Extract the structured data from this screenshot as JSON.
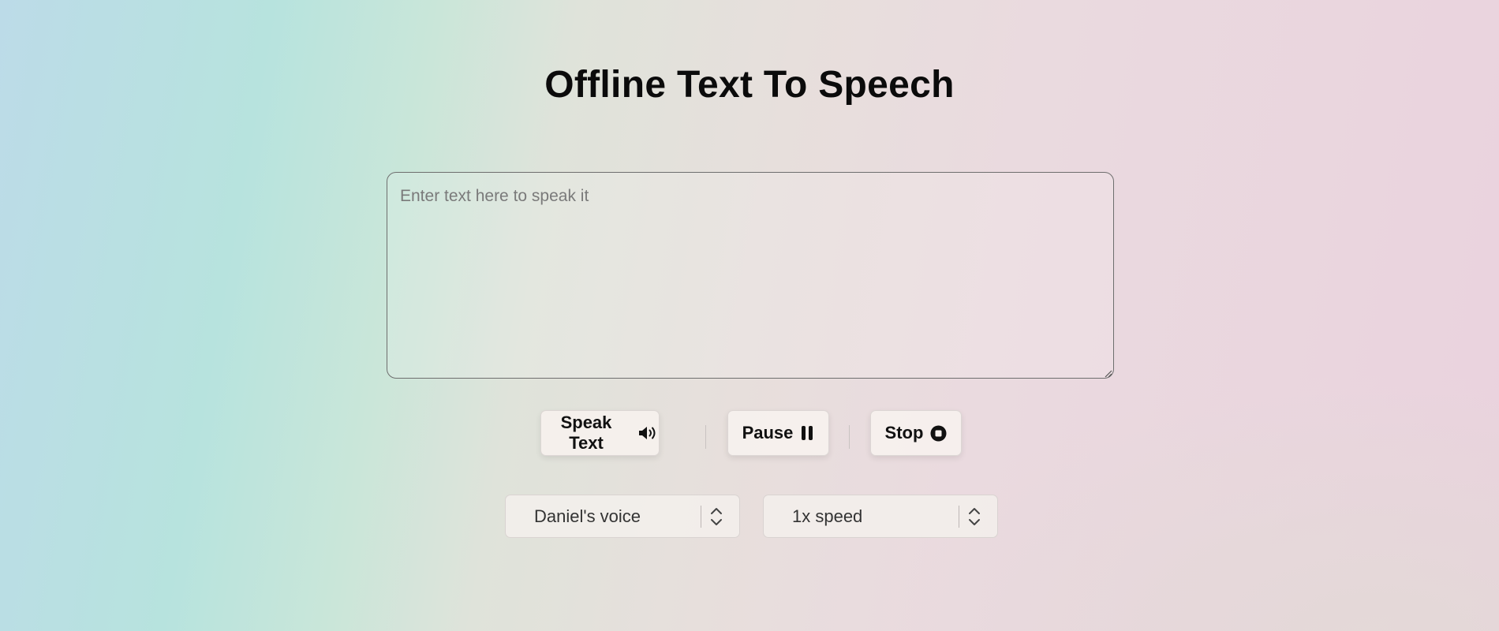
{
  "page": {
    "title": "Offline Text To Speech"
  },
  "input": {
    "placeholder": "Enter text here to speak it",
    "value": ""
  },
  "controls": {
    "speak_label": "Speak Text",
    "speak_icon": "speaker-volume-icon",
    "pause_label": "Pause",
    "pause_icon": "pause-icon",
    "stop_label": "Stop",
    "stop_icon": "stop-circle-icon"
  },
  "settings": {
    "voice": {
      "selected": "Daniel's voice",
      "icon": "chevron-up-down-icon"
    },
    "speed": {
      "selected": "1x speed",
      "icon": "chevron-up-down-icon"
    }
  },
  "colors": {
    "text": "#0b0b0b",
    "button_bg": "#f6f1ee",
    "textarea_border": "#6e6e6e"
  }
}
